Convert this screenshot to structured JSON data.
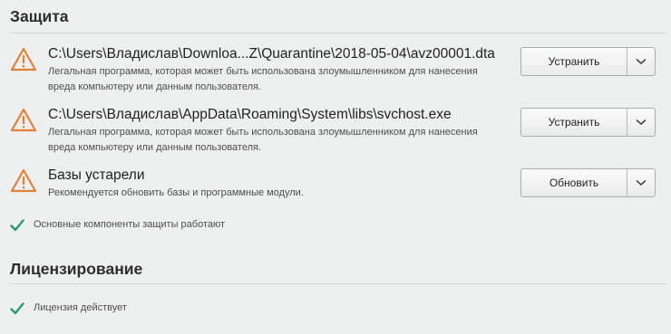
{
  "protection": {
    "title": "Защита",
    "items": [
      {
        "title": "C:\\Users\\Владислав\\Downloa...Z\\Quarantine\\2018-05-04\\avz00001.dta",
        "description": "Легальная программа, которая может быть использована злоумышленником для нанесения вреда компьютеру или данным пользователя.",
        "action_label": "Устранить",
        "icon": "warning-triangle-icon"
      },
      {
        "title": "C:\\Users\\Владислав\\AppData\\Roaming\\System\\libs\\svchost.exe",
        "description": "Легальная программа, которая может быть использована злоумышленником для нанесения вреда компьютеру или данным пользователя.",
        "action_label": "Устранить",
        "icon": "warning-triangle-icon"
      },
      {
        "title": "Базы устарели",
        "description": "Рекомендуется обновить базы и программные модули.",
        "action_label": "Обновить",
        "icon": "warning-triangle-icon"
      }
    ],
    "status_text": "Основные компоненты защиты работают"
  },
  "licensing": {
    "title": "Лицензирование",
    "status_text": "Лицензия действует"
  },
  "colors": {
    "warning": "#e0813a",
    "ok": "#2a9a6e",
    "background": "#eef0ef"
  }
}
